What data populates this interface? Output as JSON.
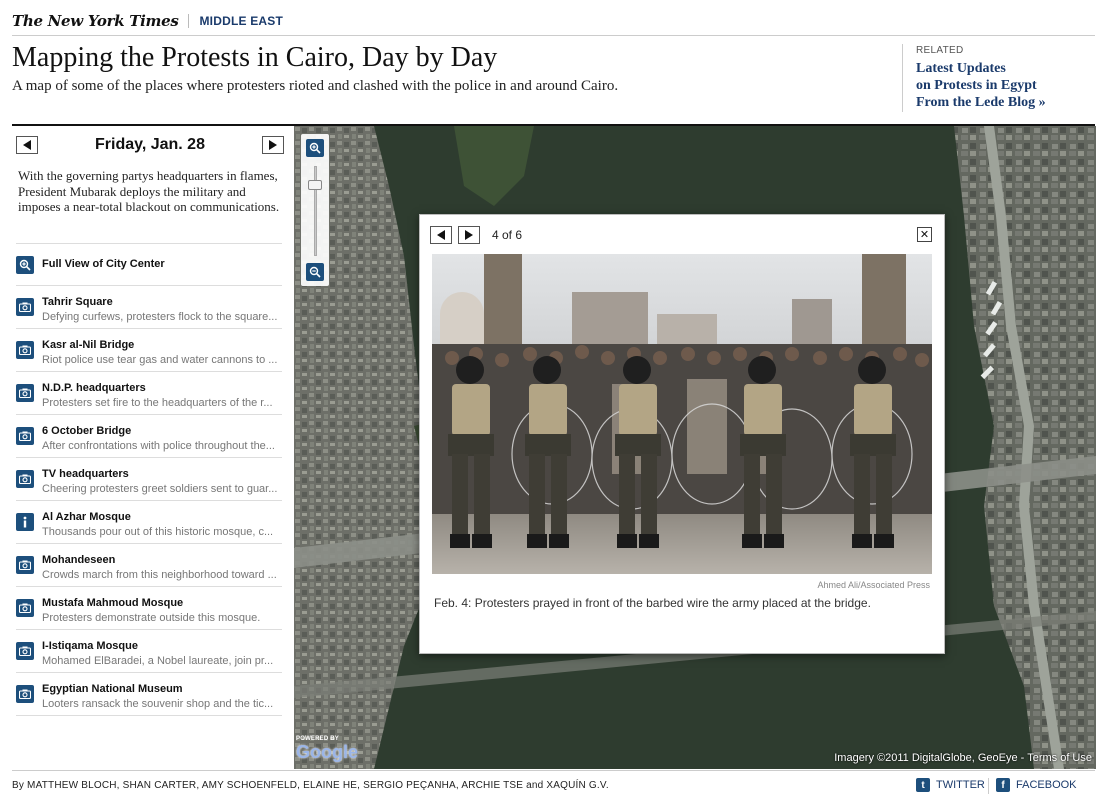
{
  "header": {
    "logo_text": "The New York Times",
    "section": "MIDDLE EAST",
    "headline": "Mapping the Protests in Cairo, Day by Day",
    "dek": "A map of some of the places where protesters rioted and clashed with the police in and around Cairo."
  },
  "related": {
    "label": "RELATED",
    "link_line1": "Latest Updates",
    "link_line2": "on Protests in Egypt",
    "link_line3": "From the Lede Blog »"
  },
  "sidebar": {
    "day": "Friday, Jan. 28",
    "description": "With the governing partys headquarters in flames, President Mubarak deploys the military and imposes a near-total blackout on communications.",
    "full_view_label": "Full View of City Center",
    "locations": [
      {
        "title": "Tahrir Square",
        "subtitle": "Defying curfews, protesters flock to the square...",
        "icon": "camera-icon"
      },
      {
        "title": "Kasr al-Nil Bridge",
        "subtitle": "Riot police use tear gas and water cannons to ...",
        "icon": "camera-icon"
      },
      {
        "title": "N.D.P. headquarters",
        "subtitle": "Protesters set fire to the headquarters of the r...",
        "icon": "camera-icon"
      },
      {
        "title": "6 October Bridge",
        "subtitle": "After confrontations with police throughout the...",
        "icon": "camera-icon"
      },
      {
        "title": "TV headquarters",
        "subtitle": "Cheering protesters greet soldiers sent to guar...",
        "icon": "camera-icon"
      },
      {
        "title": "Al Azhar Mosque",
        "subtitle": "Thousands pour out of this historic mosque, c...",
        "icon": "info-icon"
      },
      {
        "title": "Mohandeseen",
        "subtitle": "Crowds march from this neighborhood toward ...",
        "icon": "camera-icon"
      },
      {
        "title": "Mustafa Mahmoud Mosque",
        "subtitle": "Protesters demonstrate outside this mosque.",
        "icon": "camera-icon"
      },
      {
        "title": "I-Istiqama Mosque",
        "subtitle": "Mohamed ElBaradei, a Nobel laureate, join pr...",
        "icon": "camera-icon"
      },
      {
        "title": "Egyptian National Museum",
        "subtitle": "Looters ransack the souvenir shop and the tic...",
        "icon": "camera-icon"
      }
    ]
  },
  "map": {
    "powered_by": "POWERED BY",
    "google": "Google",
    "credits": "Imagery ©2011 DigitalGlobe, GeoEye - Terms of Use"
  },
  "popup": {
    "count": "4 of 6",
    "close_label": "✕",
    "photo_credit": "Ahmed Ali/Associated Press",
    "caption": "Feb. 4: Protesters prayed in front of the barbed wire the army placed at the bridge."
  },
  "footer": {
    "byline": "By MATTHEW BLOCH, SHAN CARTER, AMY SCHOENFELD, ELAINE HE, SERGIO PEÇANHA, ARCHIE TSE and XAQUÍN G.V.",
    "twitter": "TWITTER",
    "facebook": "FACEBOOK"
  },
  "colors": {
    "link_blue": "#1a3a6b",
    "icon_blue": "#1d4f7c",
    "map_land": "#2f3d2f"
  }
}
